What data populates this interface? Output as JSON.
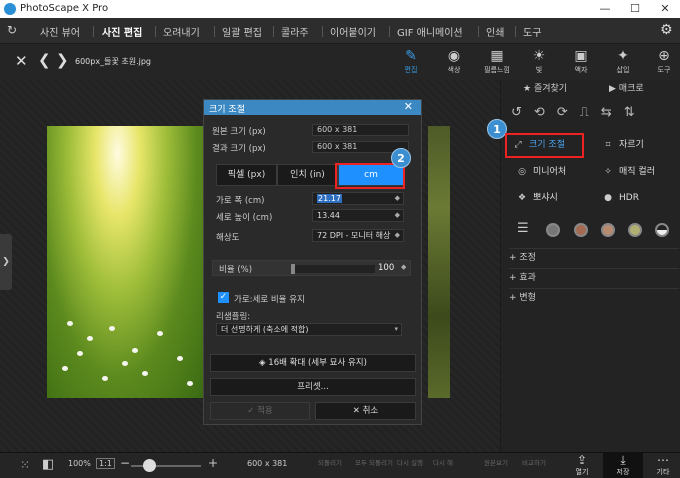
{
  "app": {
    "title": "PhotoScape X Pro",
    "minimize": "—",
    "maximize": "☐",
    "close": "✕"
  },
  "menu": {
    "items": [
      "사진 뷰어",
      "사진 편집",
      "오려내기",
      "일괄 편집",
      "콜라주",
      "이어붙이기",
      "GIF 애니메이션",
      "인쇄",
      "도구"
    ],
    "active": "사진 편집"
  },
  "toolbar": {
    "file_name": "600px_들꽃 초원.jpg",
    "tools": [
      "편집",
      "색상",
      "필름느낌",
      "빛",
      "액자",
      "삽입",
      "도구"
    ],
    "active_tool": "편집"
  },
  "dialog": {
    "title": "크기 조절",
    "original_label": "원본 크기 (px)",
    "original_value": "600 x 381",
    "result_label": "결과 크기 (px)",
    "result_value": "600 x 381",
    "units": [
      "픽셀 (px)",
      "인치 (in)",
      "cm"
    ],
    "selected_unit": "cm",
    "width_label": "가로 폭 (cm)",
    "width_value": "21.17",
    "height_label": "세로 높이 (cm)",
    "height_value": "13.44",
    "resolution_label": "해상도",
    "resolution_value": "72 DPI - 모니터 해상",
    "ratio_label": "비율 (%)",
    "ratio_value": "100",
    "keep_ratio_label": "가로:세로 비율 유지",
    "keep_ratio_checked": true,
    "resampling_label": "리샘플링:",
    "resampling_value": "더 선명하게 (축소에 적합)",
    "upscale_label": "16배 확대 (세부 묘사 유지)",
    "preset_label": "프리셋...",
    "ok_label": "✓ 적용",
    "cancel_label": "✕ 취소"
  },
  "callouts": [
    "1",
    "2"
  ],
  "right_panel": {
    "tab_favorites": "즐겨찾기",
    "tab_macro": "매크로",
    "tools": [
      "크기 조절",
      "자르기",
      "미니어처",
      "매직 컬러",
      "뽀샤시",
      "HDR"
    ],
    "sections": [
      "조정",
      "효과",
      "변형"
    ]
  },
  "statusbar": {
    "zoom": "100%",
    "ratio_btn": "1:1",
    "size": "600 x 381",
    "actions": [
      "되돌리기",
      "모두 되돌리기",
      "다시 실행",
      "다시 해",
      "원본보기",
      "비교하기"
    ],
    "open": "열기",
    "save": "저장",
    "more": "기타"
  },
  "colors": {
    "accent": "#1e90ff",
    "dialog_title": "#3b88c3",
    "callout": "#3b8fd0",
    "highlight_border": "#ee2222"
  }
}
